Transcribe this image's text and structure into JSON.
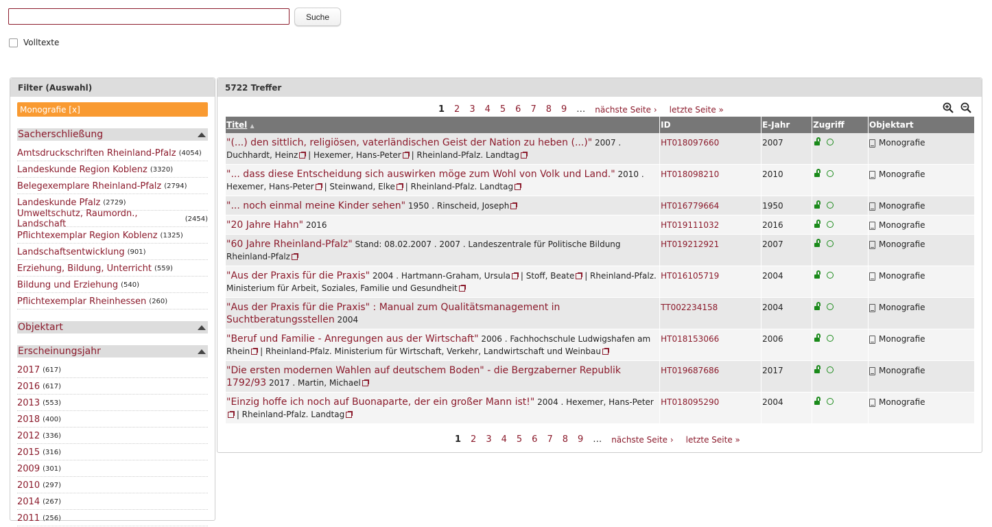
{
  "search": {
    "placeholder": "",
    "value": "",
    "button": "Suche"
  },
  "fulltext": {
    "label": "Volltexte",
    "checked": false
  },
  "filter": {
    "title": "Filter (Auswahl)",
    "selected": "Monografie [x]",
    "facets": [
      {
        "title": "Sacherschließung",
        "items": [
          {
            "label": "Amtsdruckschriften Rheinland-Pfalz",
            "count": "(4054)"
          },
          {
            "label": "Landeskunde Region Koblenz",
            "count": "(3320)"
          },
          {
            "label": "Belegexemplare Rheinland-Pfalz",
            "count": "(2794)"
          },
          {
            "label": "Landeskunde Pfalz",
            "count": "(2729)"
          },
          {
            "label": "Umweltschutz, Raumordn., Landschaft",
            "count": "(2454)"
          },
          {
            "label": "Pflichtexemplar Region Koblenz",
            "count": "(1325)"
          },
          {
            "label": "Landschaftsentwicklung",
            "count": "(901)"
          },
          {
            "label": "Erziehung, Bildung, Unterricht",
            "count": "(559)"
          },
          {
            "label": "Bildung und Erziehung",
            "count": "(540)"
          },
          {
            "label": "Pflichtexemplar Rheinhessen",
            "count": "(260)"
          }
        ]
      },
      {
        "title": "Objektart",
        "items": []
      },
      {
        "title": "Erscheinungsjahr",
        "items": [
          {
            "label": "2017",
            "count": "(617)"
          },
          {
            "label": "2016",
            "count": "(617)"
          },
          {
            "label": "2013",
            "count": "(553)"
          },
          {
            "label": "2018",
            "count": "(400)"
          },
          {
            "label": "2012",
            "count": "(336)"
          },
          {
            "label": "2015",
            "count": "(316)"
          },
          {
            "label": "2009",
            "count": "(301)"
          },
          {
            "label": "2010",
            "count": "(297)"
          },
          {
            "label": "2014",
            "count": "(267)"
          },
          {
            "label": "2011",
            "count": "(256)"
          }
        ]
      }
    ]
  },
  "results": {
    "title": "5722 Treffer",
    "pager": {
      "current": "1",
      "pages": [
        "2",
        "3",
        "4",
        "5",
        "6",
        "7",
        "8",
        "9"
      ],
      "dots": "…",
      "next": "nächste Seite ›",
      "last": "letzte Seite »"
    },
    "columns": [
      "Titel",
      "ID",
      "E-Jahr",
      "Zugriff",
      "Objektart"
    ],
    "rows": [
      {
        "title": "\"(...) den sittlich, religiösen, vaterländischen Geist der Nation zu heben (...)\"",
        "meta": [
          " 2007 . Duchhardt, Heinz",
          "| Hexemer, Hans-Peter",
          "| Rheinland-Pfalz. Landtag"
        ],
        "id": "HT018097660",
        "year": "2007",
        "type": "Monografie"
      },
      {
        "title": "\"... dass diese Entscheidung sich auswirken möge zum Wohl von Volk und Land.\"",
        "meta": [
          " 2010 . Hexemer, Hans-Peter",
          "| Steinwand, Elke",
          "| Rheinland-Pfalz. Landtag"
        ],
        "id": "HT018098210",
        "year": "2010",
        "type": "Monografie"
      },
      {
        "title": "\"... noch einmal meine Kinder sehen\"",
        "meta": [
          " 1950 . Rinscheid, Joseph"
        ],
        "id": "HT016779664",
        "year": "1950",
        "type": "Monografie"
      },
      {
        "title": "\"20 Jahre Hahn\"",
        "meta": [
          " 2016"
        ],
        "id": "HT019111032",
        "year": "2016",
        "type": "Monografie"
      },
      {
        "title": "\"60 Jahre Rheinland-Pfalz\"",
        "meta": [
          " Stand: 08.02.2007 . 2007 . Landeszentrale für Politische Bildung Rheinland-Pfalz"
        ],
        "id": "HT019212921",
        "year": "2007",
        "type": "Monografie"
      },
      {
        "title": "\"Aus der Praxis für die Praxis\"",
        "meta": [
          " 2004 . Hartmann-Graham, Ursula",
          "| Stoff, Beate",
          "| Rheinland-Pfalz. Ministerium für Arbeit, Soziales, Familie und Gesundheit"
        ],
        "id": "HT016105719",
        "year": "2004",
        "type": "Monografie"
      },
      {
        "title": "\"Aus der Praxis für die Praxis\" : Manual zum Qualitätsmanagement in Suchtberatungsstellen",
        "meta": [
          " 2004"
        ],
        "id": "TT002234158",
        "year": "2004",
        "type": "Monografie",
        "nolink": true
      },
      {
        "title": "\"Beruf und Familie - Anregungen aus der Wirtschaft\"",
        "meta": [
          " 2006 . Fachhochschule Ludwigshafen am Rhein",
          "| Rheinland-Pfalz. Ministerium für Wirtschaft, Verkehr, Landwirtschaft und Weinbau"
        ],
        "id": "HT018153066",
        "year": "2006",
        "type": "Monografie"
      },
      {
        "title": "\"Die ersten modernen Wahlen auf deutschem Boden\" - die Bergzaberner Republik 1792/93",
        "meta": [
          " 2017 . Martin, Michael"
        ],
        "id": "HT019687686",
        "year": "2017",
        "type": "Monografie"
      },
      {
        "title": "\"Einzig hoffe ich noch auf Buonaparte, der ein großer Mann ist!\"",
        "meta": [
          " 2004 . Hexemer, Hans-Peter",
          "| Rheinland-Pfalz. Landtag"
        ],
        "id": "HT018095290",
        "year": "2004",
        "type": "Monografie"
      }
    ]
  },
  "colors": {
    "accent": "#8b1a2b",
    "selected": "#f99a31",
    "open_access": "#1a8a1a"
  },
  "icons": {
    "zoom_in": "zoom-in-icon",
    "zoom_out": "zoom-out-icon",
    "sort": "sort-asc-icon",
    "external": "external-link-icon",
    "lock": "lock-open-icon",
    "book": "book-icon"
  }
}
